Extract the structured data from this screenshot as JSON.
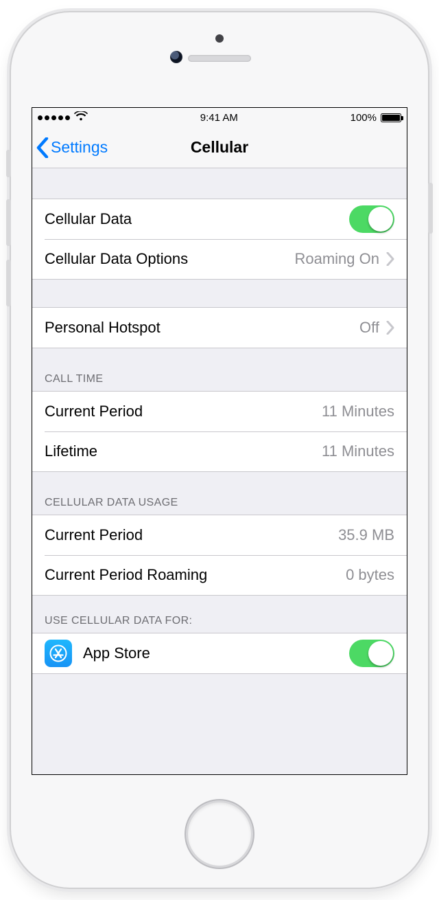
{
  "statusbar": {
    "time": "9:41 AM",
    "battery_pct": "100%"
  },
  "nav": {
    "back_label": "Settings",
    "title": "Cellular"
  },
  "rows": {
    "cellular_data": {
      "label": "Cellular Data"
    },
    "cellular_data_options": {
      "label": "Cellular Data Options",
      "value": "Roaming On"
    },
    "personal_hotspot": {
      "label": "Personal Hotspot",
      "value": "Off"
    }
  },
  "sections": {
    "call_time": {
      "header": "CALL TIME",
      "current_period": {
        "label": "Current Period",
        "value": "11 Minutes"
      },
      "lifetime": {
        "label": "Lifetime",
        "value": "11 Minutes"
      }
    },
    "data_usage": {
      "header": "CELLULAR DATA USAGE",
      "current_period": {
        "label": "Current Period",
        "value": "35.9 MB"
      },
      "current_period_roaming": {
        "label": "Current Period Roaming",
        "value": "0 bytes"
      }
    },
    "use_data_for": {
      "header": "USE CELLULAR DATA FOR:",
      "app_store": {
        "label": "App Store"
      }
    }
  }
}
